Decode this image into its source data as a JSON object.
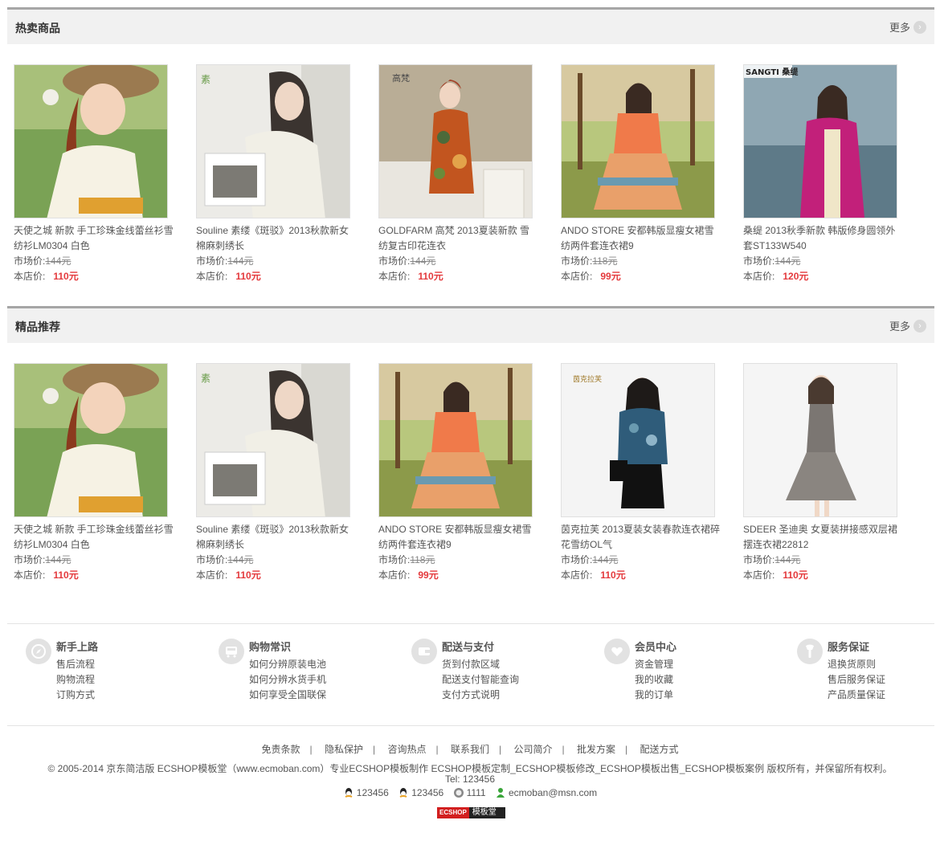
{
  "sections": [
    {
      "title": "热卖商品",
      "more_label": "更多",
      "products": [
        {
          "name": "天使之城 新款 手工珍珠金线蕾丝衫雪纺衫LM0304 白色",
          "market_label": "市场价:",
          "market_price": "144元",
          "shop_label": "本店价:",
          "shop_price": "110元"
        },
        {
          "name": "Souline 素缕《斑驳》2013秋款新女棉麻刺绣长",
          "market_label": "市场价:",
          "market_price": "144元",
          "shop_label": "本店价:",
          "shop_price": "110元"
        },
        {
          "name": "GOLDFARM 高梵 2013夏装新款 雪纺复古印花连衣",
          "market_label": "市场价:",
          "market_price": "144元",
          "shop_label": "本店价:",
          "shop_price": "110元"
        },
        {
          "name": "ANDO STORE 安都韩版显瘦女裙雪纺两件套连衣裙9",
          "market_label": "市场价:",
          "market_price": "118元",
          "shop_label": "本店价:",
          "shop_price": "99元"
        },
        {
          "name": "桑缇 2013秋季新款 韩版修身圆领外套ST133W540",
          "market_label": "市场价:",
          "market_price": "144元",
          "shop_label": "本店价:",
          "shop_price": "120元"
        }
      ]
    },
    {
      "title": "精品推荐",
      "more_label": "更多",
      "products": [
        {
          "name": "天使之城 新款 手工珍珠金线蕾丝衫雪纺衫LM0304 白色",
          "market_label": "市场价:",
          "market_price": "144元",
          "shop_label": "本店价:",
          "shop_price": "110元"
        },
        {
          "name": "Souline 素缕《斑驳》2013秋款新女棉麻刺绣长",
          "market_label": "市场价:",
          "market_price": "144元",
          "shop_label": "本店价:",
          "shop_price": "110元"
        },
        {
          "name": "ANDO STORE 安都韩版显瘦女裙雪纺两件套连衣裙9",
          "market_label": "市场价:",
          "market_price": "118元",
          "shop_label": "本店价:",
          "shop_price": "99元"
        },
        {
          "name": "茵克拉芙 2013夏装女装春款连衣裙碎花雪纺OL气",
          "market_label": "市场价:",
          "market_price": "144元",
          "shop_label": "本店价:",
          "shop_price": "110元"
        },
        {
          "name": "SDEER 圣迪奥 女夏装拼接感双层裙摆连衣裙22812",
          "market_label": "市场价:",
          "market_price": "144元",
          "shop_label": "本店价:",
          "shop_price": "110元"
        }
      ]
    }
  ],
  "image_brand_marks": {
    "p2": "高梵",
    "p4": "SANGTI 桑缇",
    "p8": "茵克拉芙"
  },
  "help": [
    {
      "title": "新手上路",
      "icon": "compass-icon",
      "links": [
        "售后流程",
        "购物流程",
        "订购方式"
      ]
    },
    {
      "title": "购物常识",
      "icon": "bus-icon",
      "links": [
        "如何分辨原装电池",
        "如何分辨水货手机",
        "如何享受全国联保"
      ]
    },
    {
      "title": "配送与支付",
      "icon": "wallet-icon",
      "links": [
        "货到付款区域",
        "配送支付智能查询",
        "支付方式说明"
      ]
    },
    {
      "title": "会员中心",
      "icon": "heart-icon",
      "links": [
        "资金管理",
        "我的收藏",
        "我的订单"
      ]
    },
    {
      "title": "服务保证",
      "icon": "wrench-icon",
      "links": [
        "退换货原则",
        "售后服务保证",
        "产品质量保证"
      ]
    }
  ],
  "bottom_links": [
    "免责条款",
    "隐私保护",
    "咨询热点",
    "联系我们",
    "公司简介",
    "批发方案",
    "配送方式"
  ],
  "copyright": "© 2005-2014 京东简洁版 ECSHOP模板堂（www.ecmoban.com）专业ECSHOP模板制作 ECSHOP模板定制_ECSHOP模板修改_ECSHOP模板出售_ECSHOP模板案例 版权所有，并保留所有权利。",
  "tel": "Tel: 123456",
  "contacts": {
    "qq1": "123456",
    "qq2": "123456",
    "ww": "1111",
    "msn": "ecmoban@msn.com"
  },
  "logo": {
    "left": "ECSHOP",
    "right": "模板堂"
  },
  "colors": {
    "accent_price": "#e4393c",
    "header_bg": "#f1f1f1",
    "header_border": "#a6a6a6"
  }
}
